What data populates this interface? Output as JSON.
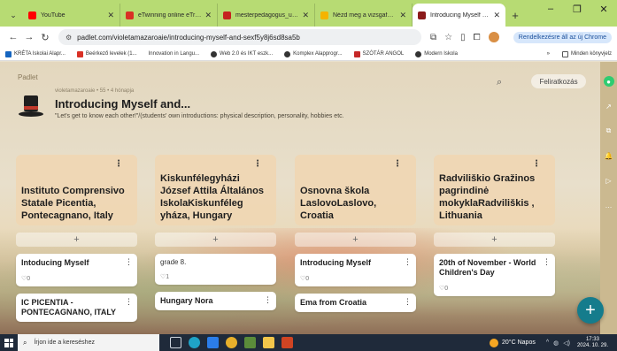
{
  "browser": {
    "tabs": [
      {
        "title": "YouTube",
        "color": "#ff0000",
        "active": false
      },
      {
        "title": "eTwinning online eTrend",
        "color": "#d93025",
        "active": false
      },
      {
        "title": "mesterpedagogus_utmu",
        "color": "#c5221f",
        "active": false
      },
      {
        "title": "Nézd meg a vizsgafelad",
        "color": "#f4b400",
        "active": false
      },
      {
        "title": "Introducing Myself and...",
        "color": "#8b1a1a",
        "active": true
      }
    ],
    "url": "padlet.com/violetamazaroaie/introducing-myself-and-sexf5y8j6sd8sa5b",
    "relaunch_label": "Rendelkezésre áll az új Chrome"
  },
  "bookmarks": [
    {
      "label": "KRÉTA Iskolai Alapr...",
      "color": "#1565c0"
    },
    {
      "label": "Beérkező levelek (1...",
      "color": "#d93025"
    },
    {
      "label": "Innovation in Langu...",
      "color": "#ffffff"
    },
    {
      "label": "Web 2.0 és IKT eszk...",
      "color": "#333333"
    },
    {
      "label": "Komplex Alapprogr...",
      "color": "#333333"
    },
    {
      "label": "SZÓTÁR ANGOL",
      "color": "#c62828"
    },
    {
      "label": "Modern Iskola",
      "color": "#333333"
    }
  ],
  "bookmarks_more": "»",
  "bookmarks_all": "Minden könyvjelz",
  "padlet": {
    "brand": "Padlet",
    "subscribe_label": "Feliratkozás",
    "meta": "violetamazaroaie • 55 • 4 hónapja",
    "title": "Introducing Myself and...",
    "description": "\"Let's get to know each other!\"/(students' own introductions: physical description, personality, hobbies etc.",
    "columns": [
      {
        "header": "Instituto Comprensivo Statale Picentia, Pontecagnano, Italy",
        "posts": [
          {
            "title": "Intoducing Myself",
            "likes": "0"
          },
          {
            "title": "IC PICENTIA - PONTECAGNANO, ITALY",
            "likes": ""
          }
        ]
      },
      {
        "header": "Kiskunfélegyházi József Attila Általános IskolaKiskunféleg yháza, Hungary",
        "posts": [
          {
            "title": "",
            "body": "grade 8.",
            "likes": "1"
          },
          {
            "title": "Hungary Nora",
            "likes": ""
          }
        ]
      },
      {
        "header": "Osnovna škola LaslovoLaslovo, Croatia",
        "posts": [
          {
            "title": "Introducing Myself",
            "likes": "0"
          },
          {
            "title": "Ema from Croatia",
            "likes": ""
          }
        ]
      },
      {
        "header": "Radviliškio Gražinos pagrindinė mokyklaRadviliškis , Lithuania",
        "posts": [
          {
            "title": "20th of November - World Children's Day",
            "likes": "0"
          }
        ]
      }
    ]
  },
  "taskbar": {
    "search_placeholder": "Írjon ide a kereséshez",
    "weather": "20°C Napos",
    "time": "17:33",
    "date": "2024. 10. 29."
  }
}
